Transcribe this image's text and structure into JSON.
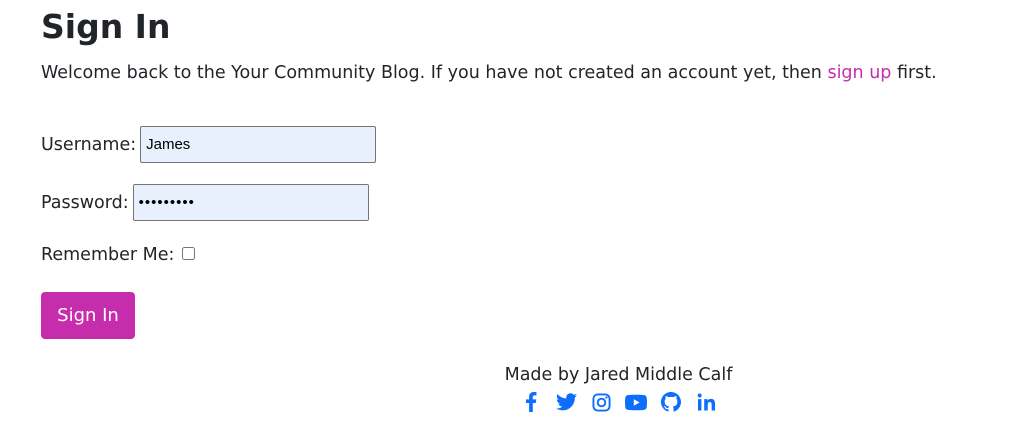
{
  "header": {
    "title": "Sign In"
  },
  "intro": {
    "text_before": "Welcome back to the Your Community Blog. If you have not created an account yet, then ",
    "signup_link": "sign up",
    "text_after": " first."
  },
  "form": {
    "username_label": "Username:",
    "username_value": "James",
    "password_label": "Password:",
    "password_value": "•••••••••",
    "remember_label": "Remember Me:",
    "remember_checked": false,
    "submit_label": "Sign In"
  },
  "colors": {
    "accent": "#c52dac",
    "link": "#c52dac",
    "social": "#0d6efd",
    "autofill_bg": "#e8f0fe"
  },
  "footer": {
    "credit": "Made by Jared Middle Calf",
    "social_icons": [
      "facebook-icon",
      "twitter-icon",
      "instagram-icon",
      "youtube-icon",
      "github-icon",
      "linkedin-icon"
    ]
  }
}
